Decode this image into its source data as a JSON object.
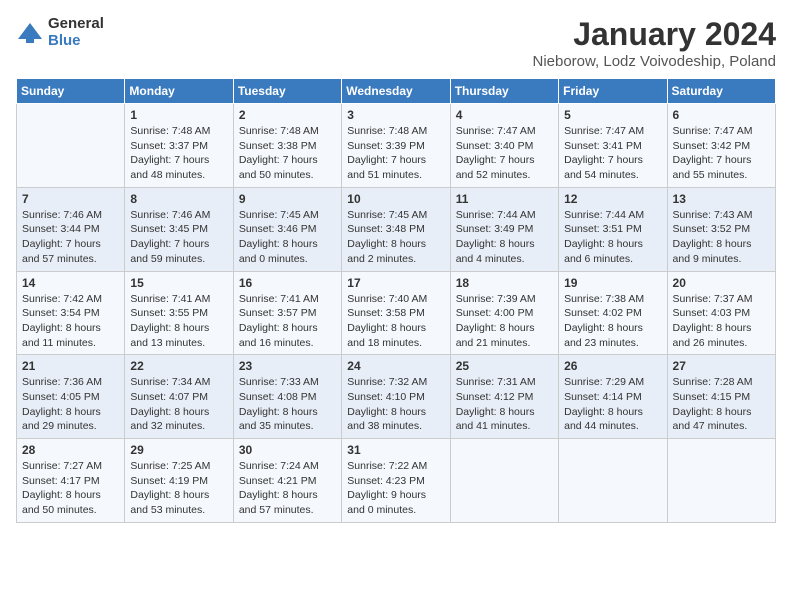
{
  "logo": {
    "general": "General",
    "blue": "Blue"
  },
  "title": "January 2024",
  "subtitle": "Nieborow, Lodz Voivodeship, Poland",
  "headers": [
    "Sunday",
    "Monday",
    "Tuesday",
    "Wednesday",
    "Thursday",
    "Friday",
    "Saturday"
  ],
  "weeks": [
    [
      {
        "day": "",
        "info": ""
      },
      {
        "day": "1",
        "info": "Sunrise: 7:48 AM\nSunset: 3:37 PM\nDaylight: 7 hours\nand 48 minutes."
      },
      {
        "day": "2",
        "info": "Sunrise: 7:48 AM\nSunset: 3:38 PM\nDaylight: 7 hours\nand 50 minutes."
      },
      {
        "day": "3",
        "info": "Sunrise: 7:48 AM\nSunset: 3:39 PM\nDaylight: 7 hours\nand 51 minutes."
      },
      {
        "day": "4",
        "info": "Sunrise: 7:47 AM\nSunset: 3:40 PM\nDaylight: 7 hours\nand 52 minutes."
      },
      {
        "day": "5",
        "info": "Sunrise: 7:47 AM\nSunset: 3:41 PM\nDaylight: 7 hours\nand 54 minutes."
      },
      {
        "day": "6",
        "info": "Sunrise: 7:47 AM\nSunset: 3:42 PM\nDaylight: 7 hours\nand 55 minutes."
      }
    ],
    [
      {
        "day": "7",
        "info": "Sunrise: 7:46 AM\nSunset: 3:44 PM\nDaylight: 7 hours\nand 57 minutes."
      },
      {
        "day": "8",
        "info": "Sunrise: 7:46 AM\nSunset: 3:45 PM\nDaylight: 7 hours\nand 59 minutes."
      },
      {
        "day": "9",
        "info": "Sunrise: 7:45 AM\nSunset: 3:46 PM\nDaylight: 8 hours\nand 0 minutes."
      },
      {
        "day": "10",
        "info": "Sunrise: 7:45 AM\nSunset: 3:48 PM\nDaylight: 8 hours\nand 2 minutes."
      },
      {
        "day": "11",
        "info": "Sunrise: 7:44 AM\nSunset: 3:49 PM\nDaylight: 8 hours\nand 4 minutes."
      },
      {
        "day": "12",
        "info": "Sunrise: 7:44 AM\nSunset: 3:51 PM\nDaylight: 8 hours\nand 6 minutes."
      },
      {
        "day": "13",
        "info": "Sunrise: 7:43 AM\nSunset: 3:52 PM\nDaylight: 8 hours\nand 9 minutes."
      }
    ],
    [
      {
        "day": "14",
        "info": "Sunrise: 7:42 AM\nSunset: 3:54 PM\nDaylight: 8 hours\nand 11 minutes."
      },
      {
        "day": "15",
        "info": "Sunrise: 7:41 AM\nSunset: 3:55 PM\nDaylight: 8 hours\nand 13 minutes."
      },
      {
        "day": "16",
        "info": "Sunrise: 7:41 AM\nSunset: 3:57 PM\nDaylight: 8 hours\nand 16 minutes."
      },
      {
        "day": "17",
        "info": "Sunrise: 7:40 AM\nSunset: 3:58 PM\nDaylight: 8 hours\nand 18 minutes."
      },
      {
        "day": "18",
        "info": "Sunrise: 7:39 AM\nSunset: 4:00 PM\nDaylight: 8 hours\nand 21 minutes."
      },
      {
        "day": "19",
        "info": "Sunrise: 7:38 AM\nSunset: 4:02 PM\nDaylight: 8 hours\nand 23 minutes."
      },
      {
        "day": "20",
        "info": "Sunrise: 7:37 AM\nSunset: 4:03 PM\nDaylight: 8 hours\nand 26 minutes."
      }
    ],
    [
      {
        "day": "21",
        "info": "Sunrise: 7:36 AM\nSunset: 4:05 PM\nDaylight: 8 hours\nand 29 minutes."
      },
      {
        "day": "22",
        "info": "Sunrise: 7:34 AM\nSunset: 4:07 PM\nDaylight: 8 hours\nand 32 minutes."
      },
      {
        "day": "23",
        "info": "Sunrise: 7:33 AM\nSunset: 4:08 PM\nDaylight: 8 hours\nand 35 minutes."
      },
      {
        "day": "24",
        "info": "Sunrise: 7:32 AM\nSunset: 4:10 PM\nDaylight: 8 hours\nand 38 minutes."
      },
      {
        "day": "25",
        "info": "Sunrise: 7:31 AM\nSunset: 4:12 PM\nDaylight: 8 hours\nand 41 minutes."
      },
      {
        "day": "26",
        "info": "Sunrise: 7:29 AM\nSunset: 4:14 PM\nDaylight: 8 hours\nand 44 minutes."
      },
      {
        "day": "27",
        "info": "Sunrise: 7:28 AM\nSunset: 4:15 PM\nDaylight: 8 hours\nand 47 minutes."
      }
    ],
    [
      {
        "day": "28",
        "info": "Sunrise: 7:27 AM\nSunset: 4:17 PM\nDaylight: 8 hours\nand 50 minutes."
      },
      {
        "day": "29",
        "info": "Sunrise: 7:25 AM\nSunset: 4:19 PM\nDaylight: 8 hours\nand 53 minutes."
      },
      {
        "day": "30",
        "info": "Sunrise: 7:24 AM\nSunset: 4:21 PM\nDaylight: 8 hours\nand 57 minutes."
      },
      {
        "day": "31",
        "info": "Sunrise: 7:22 AM\nSunset: 4:23 PM\nDaylight: 9 hours\nand 0 minutes."
      },
      {
        "day": "",
        "info": ""
      },
      {
        "day": "",
        "info": ""
      },
      {
        "day": "",
        "info": ""
      }
    ]
  ]
}
